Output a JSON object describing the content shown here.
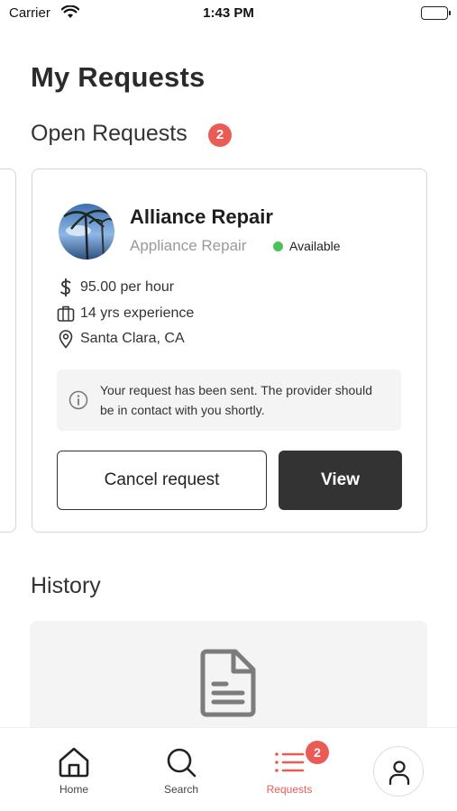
{
  "status_bar": {
    "carrier": "Carrier",
    "time": "1:43 PM"
  },
  "page": {
    "title": "My Requests"
  },
  "open_requests": {
    "title": "Open Requests",
    "count": "2",
    "card": {
      "provider_name": "Alliance Repair",
      "category": "Appliance Repair",
      "availability": "Available",
      "availability_color": "#4cc25a",
      "rate": "95.00 per hour",
      "experience": "14 yrs experience",
      "location": "Santa Clara, CA",
      "notice": "Your request has been sent. The provider should be in contact with you shortly.",
      "cancel_label": "Cancel request",
      "view_label": "View"
    }
  },
  "history": {
    "title": "History",
    "icon": "document-icon"
  },
  "tab_bar": {
    "tabs": [
      {
        "label": "Home",
        "icon": "home-icon"
      },
      {
        "label": "Search",
        "icon": "search-icon"
      },
      {
        "label": "Requests",
        "icon": "list-icon",
        "badge": "2",
        "active": true
      }
    ],
    "profile_icon": "user-icon"
  },
  "colors": {
    "accent": "#ea5b55",
    "dark_button": "#333333",
    "muted_text": "#9a9a9a"
  }
}
